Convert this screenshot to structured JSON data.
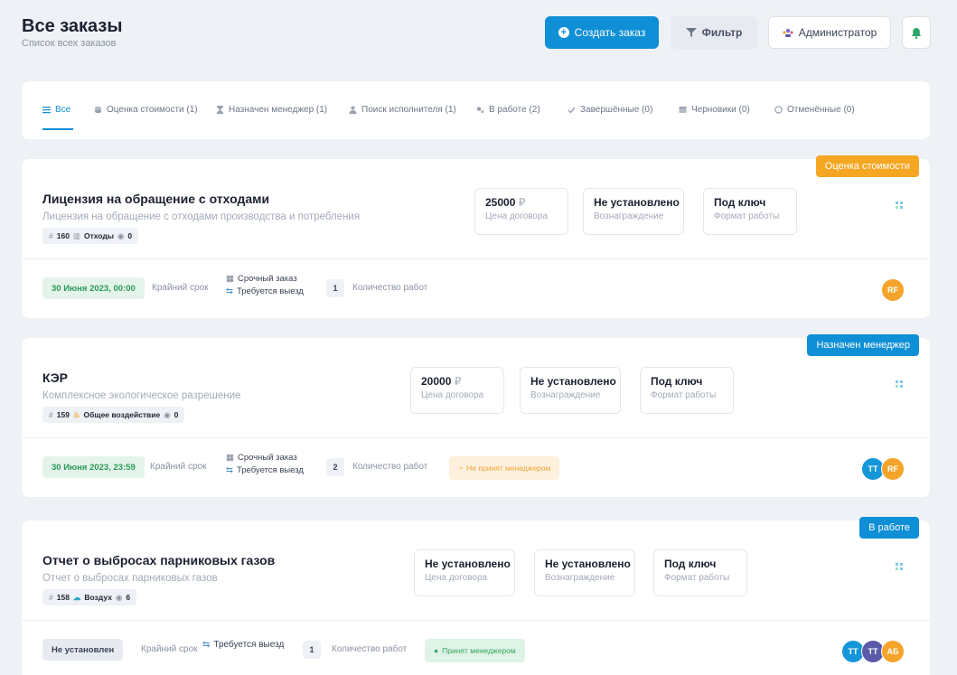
{
  "header": {
    "title": "Все заказы",
    "subtitle": "Список всех заказов",
    "create_label": "Создать заказ",
    "filter_label": "Фильтр",
    "admin_label": "Администратор"
  },
  "tabs": [
    {
      "label": "Все",
      "icon": "list-icon"
    },
    {
      "label": "Оценка стоимости (1)",
      "icon": "coin-icon"
    },
    {
      "label": "Назначен менеджер (1)",
      "icon": "hourglass-icon"
    },
    {
      "label": "Поиск исполнителя (1)",
      "icon": "person-icon"
    },
    {
      "label": "В работе (2)",
      "icon": "gears-icon"
    },
    {
      "label": "Завершённые (0)",
      "icon": "check-icon"
    },
    {
      "label": "Черновики (0)",
      "icon": "draft-icon"
    },
    {
      "label": "Отменённые (0)",
      "icon": "cancel-icon"
    }
  ],
  "orders": [
    {
      "status": "Оценка стоимости",
      "status_color": "#f5a623",
      "title": "Лицензия на обращение с отходами",
      "description": "Лицензия на обращение с отходами производства и потребления",
      "number": "160",
      "category": "Отходы",
      "views": "0",
      "price": "25000",
      "currency": "₽",
      "price_label": "Цена договора",
      "reward": "Не установлено",
      "reward_label": "Вознаграждение",
      "format": "Под ключ",
      "format_label": "Формат работы",
      "deadline": "30 Июня 2023, 00:00",
      "deadline_label": "Крайний срок",
      "urgent": "Срочный заказ",
      "visit": "Требуется выезд",
      "works_count": "1",
      "works_label": "Количество работ",
      "avatars": [
        {
          "initials": "RF",
          "color": "#f4a42a"
        }
      ]
    },
    {
      "status": "Назначен менеджер",
      "status_color": "#0f8fd6",
      "title": "КЭР",
      "description": "Комплексное экологическое разрешение",
      "number": "159",
      "category": "Общее воздействие",
      "views": "0",
      "price": "20000",
      "currency": "₽",
      "price_label": "Цена договора",
      "reward": "Не установлено",
      "reward_label": "Вознаграждение",
      "format": "Под ключ",
      "format_label": "Формат работы",
      "deadline": "30 Июня 2023, 23:59",
      "deadline_label": "Крайний срок",
      "urgent": "Срочный заказ",
      "visit": "Требуется выезд",
      "works_count": "2",
      "works_label": "Количество работ",
      "manager_status": "Не принят менеджером",
      "avatars": [
        {
          "initials": "TT",
          "color": "#1596d8"
        },
        {
          "initials": "RF",
          "color": "#f4a42a"
        }
      ]
    },
    {
      "status": "В работе",
      "status_color": "#0f8fd6",
      "title": "Отчет о выбросах парниковых газов",
      "description": "Отчет о выбросах парниковых газов",
      "number": "158",
      "category": "Воздух",
      "views": "6",
      "price": "Не установлено",
      "price_label": "Цена договора",
      "reward": "Не установлено",
      "reward_label": "Вознаграждение",
      "format": "Под ключ",
      "format_label": "Формат работы",
      "deadline": "Не установлен",
      "deadline_label": "Крайний срок",
      "visit": "Требуется выезд",
      "works_count": "1",
      "works_label": "Количество работ",
      "manager_status": "Принят менеджером",
      "avatars": [
        {
          "initials": "TT",
          "color": "#1596d8"
        },
        {
          "initials": "ТТ",
          "color": "#5a5aa8"
        },
        {
          "initials": "АБ",
          "color": "#f4a42a"
        }
      ]
    }
  ]
}
